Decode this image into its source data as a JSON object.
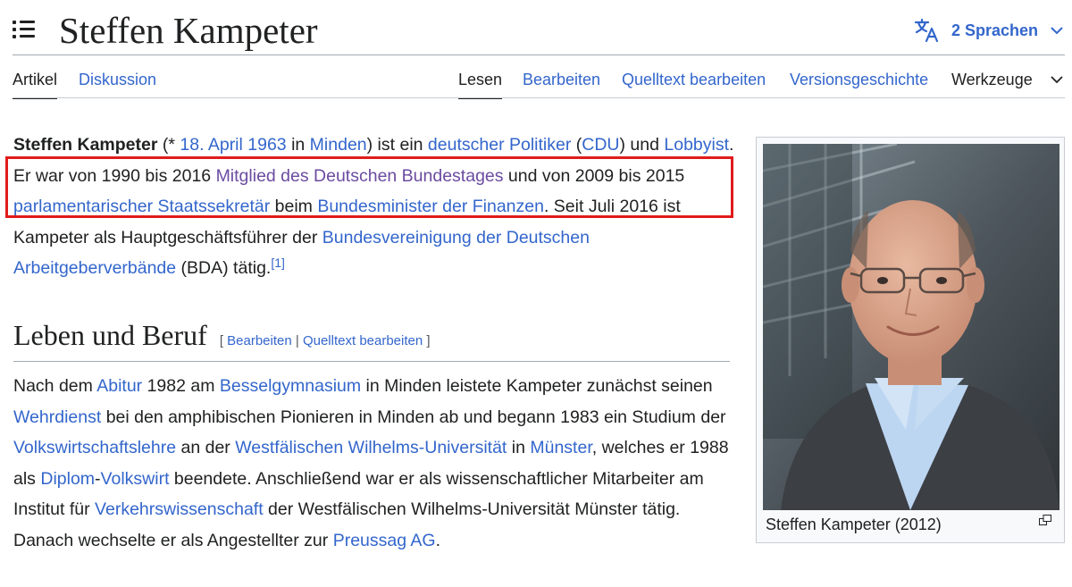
{
  "header": {
    "title": "Steffen Kampeter",
    "languages_label": "2 Sprachen"
  },
  "tabs": {
    "article": "Artikel",
    "discussion": "Diskussion",
    "read": "Lesen",
    "edit": "Bearbeiten",
    "edit_source": "Quelltext bearbeiten",
    "history": "Versionsgeschichte",
    "tools": "Werkzeuge"
  },
  "intro": {
    "name": "Steffen Kampeter",
    "t1": " (* ",
    "birth_date": "18. April 1963",
    "t2": " in ",
    "birth_place": "Minden",
    "t3": ") ist ein ",
    "politician": "deutscher Politiker",
    "t4": " (",
    "party": "CDU",
    "t5": ") und ",
    "lobbyist": "Lobbyist",
    "t6": ". Er war von 1990 bis 2016 ",
    "bundestag": "Mitglied des Deutschen Bundestages",
    "t7": " und von 2009 bis 2015 ",
    "staatssekretaer": "parlamentarischer Staatssekretär",
    "t8": " beim ",
    "finanzminister": "Bundesminister der Finanzen",
    "t9": ". Seit Juli 2016 ist Kampeter als Hauptgeschäftsführer der ",
    "bda": "Bundesvereinigung der Deutschen Arbeitgeberverbände",
    "t10": " (BDA) tätig.",
    "ref": "[1]"
  },
  "section": {
    "heading": "Leben und Beruf",
    "edit_open": "[ ",
    "edit": "Bearbeiten",
    "sep": " | ",
    "edit_source": "Quelltext bearbeiten",
    "edit_close": " ]"
  },
  "para2": {
    "t1": "Nach dem ",
    "abitur": "Abitur",
    "t2": " 1982 am ",
    "gymnasium": "Besselgymnasium",
    "t3": " in Minden leistete Kampeter zunächst seinen ",
    "wehrdienst": "Wehrdienst",
    "t4": " bei den amphibischen Pionieren in Minden ab und begann 1983 ein Studium der ",
    "vwl": "Volkswirtschaftslehre",
    "t5": " an der ",
    "uni": "Westfälischen Wilhelms-Universität",
    "t6": " in ",
    "muenster": "Münster",
    "t7": ", welches er 1988 als ",
    "diplom": "Diplom",
    "t8": "-",
    "volkswirt": "Volkswirt",
    "t9": " beendete. Anschließend war er als wissenschaftlicher Mitarbeiter am Institut für ",
    "verkehr": "Verkehrswissenschaft",
    "t10": " der Westfälischen Wilhelms-Universität Münster tätig. Danach wechselte er als Angestellter zur ",
    "preussag": "Preussag AG",
    "t11": "."
  },
  "image": {
    "caption": "Steffen Kampeter (2012)"
  },
  "colors": {
    "link": "#3366cc",
    "visited_link": "#6b4ba1",
    "highlight": "#e01b1b"
  }
}
